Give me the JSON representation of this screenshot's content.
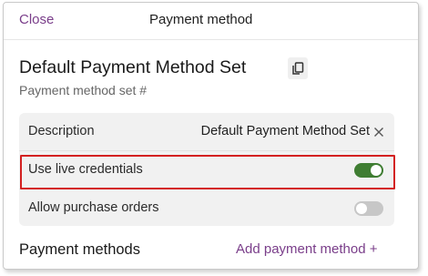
{
  "header": {
    "close_label": "Close",
    "title": "Payment method"
  },
  "payment_set": {
    "title": "Default Payment Method Set",
    "subtitle": "Payment method set #"
  },
  "settings": {
    "description_label": "Description",
    "description_value": "Default Payment Method Set",
    "live_credentials_label": "Use live credentials",
    "live_credentials_on": true,
    "purchase_orders_label": "Allow purchase orders",
    "purchase_orders_on": false
  },
  "payment_methods": {
    "title": "Payment methods",
    "add_label": "Add payment method +"
  },
  "colors": {
    "link": "#7a3e8a",
    "toggle_on": "#3f7d32",
    "toggle_off": "#c7c7c7",
    "highlight": "#d32020"
  }
}
